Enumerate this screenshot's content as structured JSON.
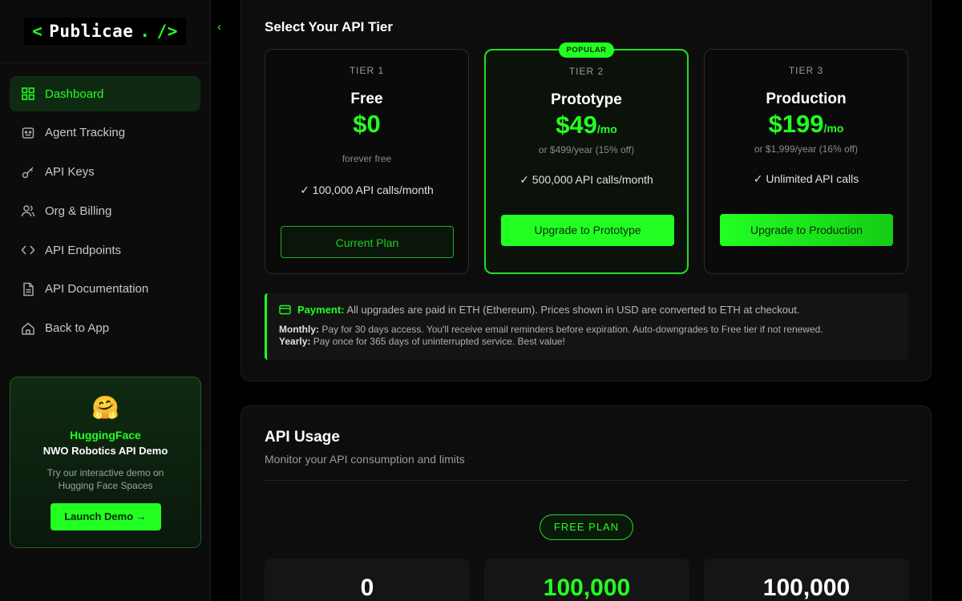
{
  "brand": {
    "open": "<",
    "name": "Publicae",
    "dot": ".",
    "close": "/>"
  },
  "sidebar": {
    "collapse_glyph": "‹",
    "items": [
      {
        "label": "Dashboard",
        "icon": "grid-icon",
        "active": true
      },
      {
        "label": "Agent Tracking",
        "icon": "robot-face-icon"
      },
      {
        "label": "API Keys",
        "icon": "key-icon"
      },
      {
        "label": "Org & Billing",
        "icon": "users-icon"
      },
      {
        "label": "API Endpoints",
        "icon": "code-icon"
      },
      {
        "label": "API Documentation",
        "icon": "document-icon"
      },
      {
        "label": "Back to App",
        "icon": "home-icon"
      }
    ],
    "promo": {
      "emoji": "🤗",
      "title": "HuggingFace",
      "subtitle": "NWO Robotics API Demo",
      "description": "Try our interactive demo on Hugging Face Spaces",
      "button_label": "Launch Demo →"
    }
  },
  "tiers_section": {
    "title": "Select Your API Tier",
    "popular_badge": "POPULAR",
    "tiers": [
      {
        "label": "TIER 1",
        "name": "Free",
        "price": "$0",
        "period": "",
        "note": "forever free",
        "feature": "✓ 100,000 API calls/month",
        "button": "Current Plan"
      },
      {
        "label": "TIER 2",
        "name": "Prototype",
        "price": "$49",
        "period": "/mo",
        "note": "or $499/year (15% off)",
        "feature": "✓ 500,000 API calls/month",
        "button": "Upgrade to Prototype"
      },
      {
        "label": "TIER 3",
        "name": "Production",
        "price": "$199",
        "period": "/mo",
        "note": "or $1,999/year (16% off)",
        "feature": "✓ Unlimited API calls",
        "button": "Upgrade to Production"
      }
    ],
    "payment": {
      "label": "Payment:",
      "text": "All upgrades are paid in ETH (Ethereum). Prices shown in USD are converted to ETH at checkout.",
      "monthly_label": "Monthly:",
      "monthly_text": "Pay for 30 days access. You'll receive email reminders before expiration. Auto-downgrades to Free tier if not renewed.",
      "yearly_label": "Yearly:",
      "yearly_text": "Pay once for 365 days of uninterrupted service. Best value!"
    }
  },
  "usage": {
    "title": "API Usage",
    "subtitle": "Monitor your API consumption and limits",
    "plan_badge": "FREE PLAN",
    "stats": [
      "0",
      "100,000",
      "100,000"
    ]
  },
  "colors": {
    "accent": "#22ff22",
    "background": "#000000",
    "panel": "#0d0d0d"
  }
}
